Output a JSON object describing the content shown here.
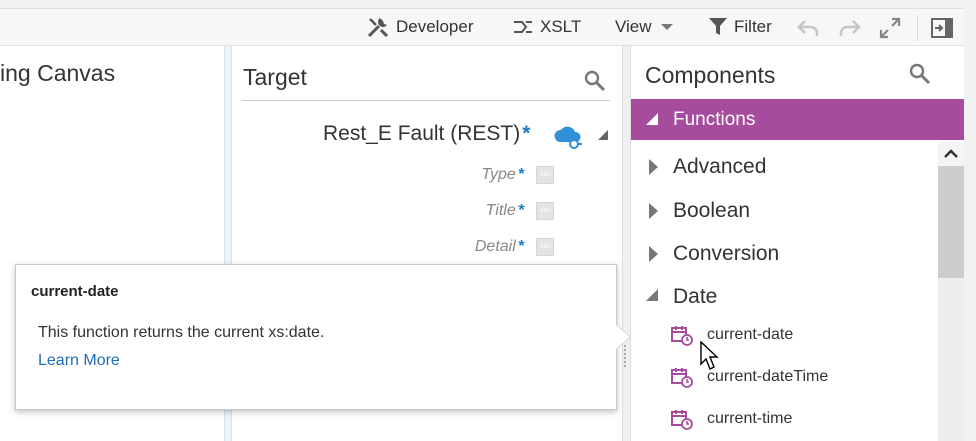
{
  "toolbar": {
    "developer_label": "Developer",
    "xslt_label": "XSLT",
    "view_label": "View",
    "filter_label": "Filter",
    "icons": [
      "tools-icon",
      "xslt-icon",
      "chevron-down-icon",
      "filter-icon",
      "undo-icon",
      "redo-icon",
      "expand-icon",
      "panel-toggle-icon"
    ]
  },
  "left_panel": {
    "title": "ing Canvas"
  },
  "target_panel": {
    "title": "Target",
    "root_node": "Rest_E Fault (REST)",
    "required_mark": "*",
    "fields": [
      {
        "label": "Type",
        "type_badge": "abc"
      },
      {
        "label": "Title",
        "type_badge": "abc"
      },
      {
        "label": "Detail",
        "type_badge": "abc"
      }
    ]
  },
  "components_panel": {
    "title": "Components",
    "section_label": "Functions",
    "categories": [
      {
        "label": "Advanced",
        "expanded": false
      },
      {
        "label": "Boolean",
        "expanded": false
      },
      {
        "label": "Conversion",
        "expanded": false
      },
      {
        "label": "Date",
        "expanded": true
      }
    ],
    "date_functions": [
      "current-date",
      "current-dateTime",
      "current-time"
    ]
  },
  "tooltip": {
    "title": "current-date",
    "description": "This function returns the current xs:date.",
    "link_label": "Learn More"
  },
  "colors": {
    "accent_purple": "#a64c9c",
    "link_blue": "#1f6db8",
    "required_blue": "#1a7bc4",
    "cloud_blue": "#2f8fd8"
  }
}
